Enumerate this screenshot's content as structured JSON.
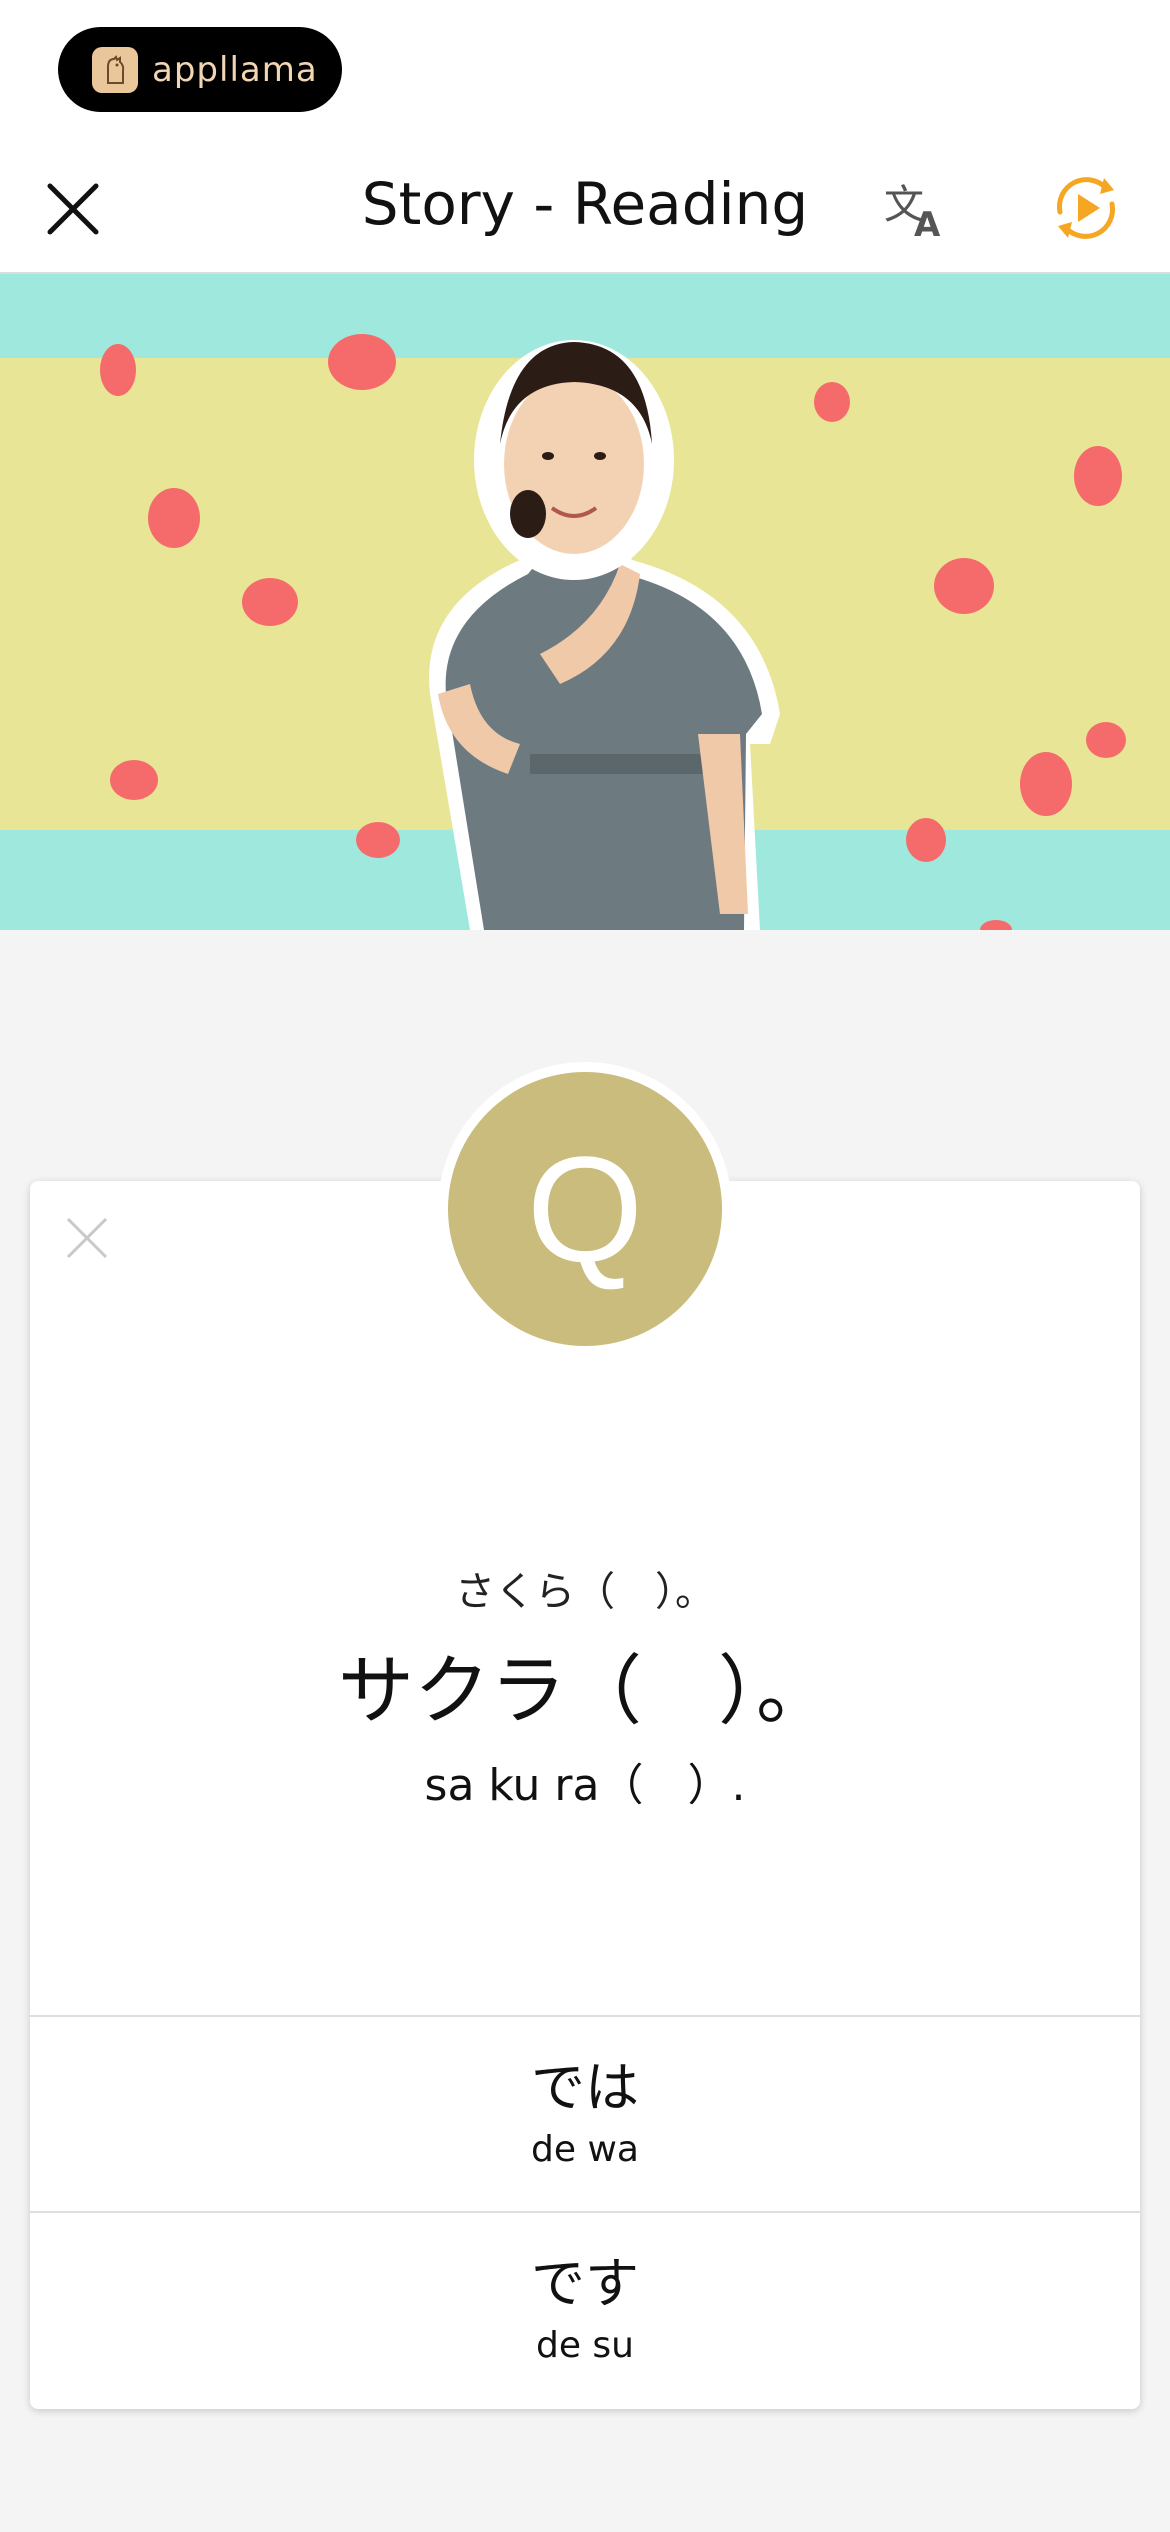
{
  "brand": {
    "name": "appllama",
    "logo_icon": "llama-icon"
  },
  "navbar": {
    "title": "Story - Reading",
    "close_icon": "close-icon",
    "translate_icon": "translate-icon",
    "replay_icon": "replay-play-icon",
    "accent_color": "#f5a623"
  },
  "hero": {
    "description_icon": "presenter-photo"
  },
  "question": {
    "badge": "Q",
    "furigana": "さくら（　）。",
    "text": "サクラ（　）。",
    "romaji": "sa ku ra（　）."
  },
  "answers": [
    {
      "kana": "では",
      "romaji": "de wa"
    },
    {
      "kana": "です",
      "romaji": "de su"
    }
  ],
  "colors": {
    "badge": "#c9bc7c",
    "hero_teal": "#9fe8de",
    "hero_yellow": "#e8e696",
    "balloon": "#f56b6b"
  }
}
